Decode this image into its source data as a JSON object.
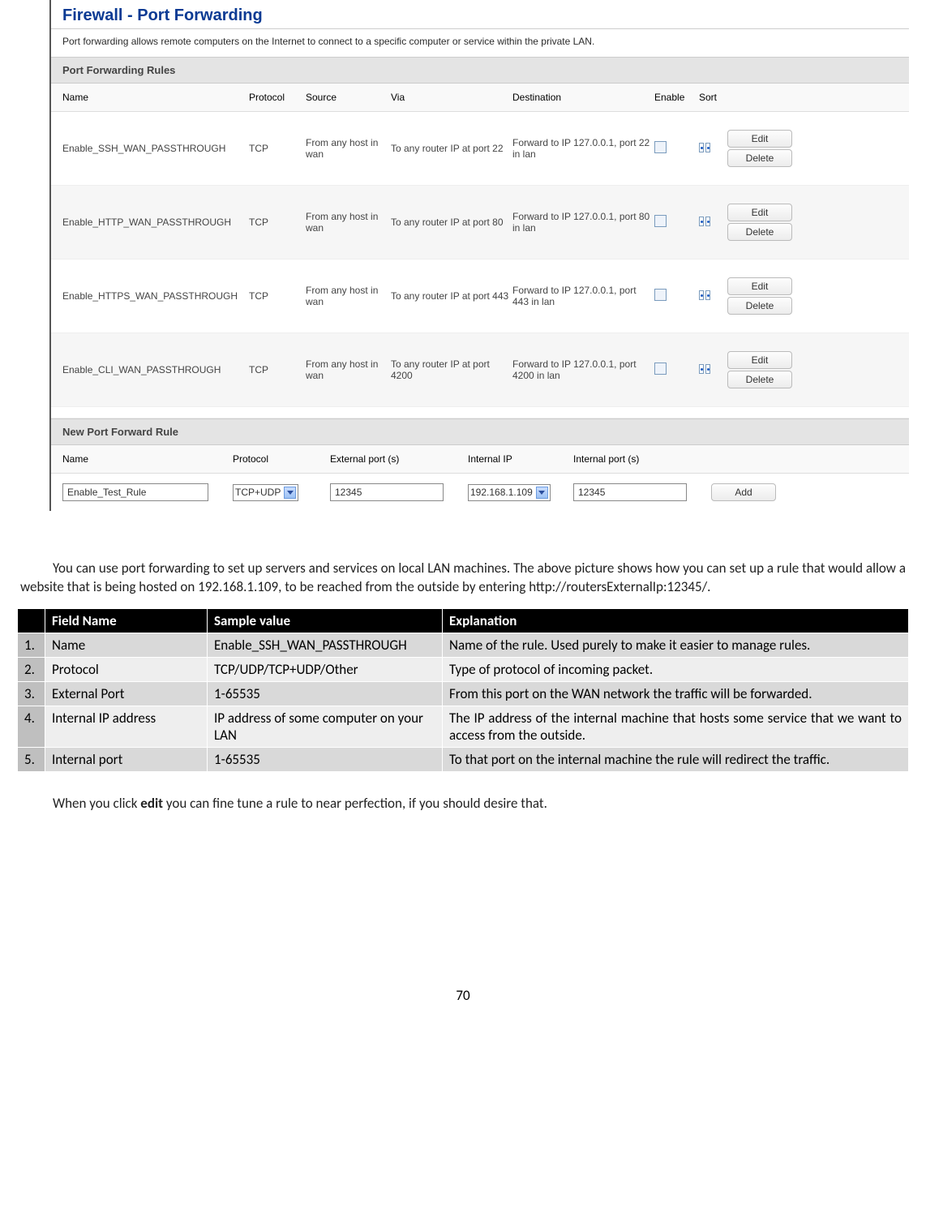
{
  "panel": {
    "title": "Firewall - Port Forwarding",
    "desc": "Port forwarding allows remote computers on the Internet to connect to a specific computer or service within the private LAN.",
    "rules_section": "Port Forwarding Rules",
    "headers": {
      "name": "Name",
      "protocol": "Protocol",
      "source": "Source",
      "via": "Via",
      "destination": "Destination",
      "enable": "Enable",
      "sort": "Sort"
    },
    "rules": [
      {
        "name": "Enable_SSH_WAN_PASSTHROUGH",
        "protocol": "TCP",
        "source": "From any host in wan",
        "via": "To any router IP at port 22",
        "dest": "Forward to IP 127.0.0.1, port 22 in lan"
      },
      {
        "name": "Enable_HTTP_WAN_PASSTHROUGH",
        "protocol": "TCP",
        "source": "From any host in wan",
        "via": "To any router IP at port 80",
        "dest": "Forward to IP 127.0.0.1, port 80 in lan"
      },
      {
        "name": "Enable_HTTPS_WAN_PASSTHROUGH",
        "protocol": "TCP",
        "source": "From any host in wan",
        "via": "To any router IP at port 443",
        "dest": "Forward to IP 127.0.0.1, port 443 in lan"
      },
      {
        "name": "Enable_CLI_WAN_PASSTHROUGH",
        "protocol": "TCP",
        "source": "From any host in wan",
        "via": "To any router IP at port 4200",
        "dest": "Forward to IP 127.0.0.1, port 4200 in lan"
      }
    ],
    "btn_edit": "Edit",
    "btn_delete": "Delete",
    "new_section": "New Port Forward Rule",
    "form_headers": {
      "name": "Name",
      "protocol": "Protocol",
      "ext": "External port (s)",
      "intip": "Internal IP",
      "intp": "Internal port (s)"
    },
    "form": {
      "name": "Enable_Test_Rule",
      "protocol": "TCP+UDP",
      "ext": "12345",
      "intip": "192.168.1.109",
      "intp": "12345",
      "add": "Add"
    }
  },
  "body1": "You can use port forwarding to set up servers and services on local LAN machines. The above picture shows how you can set up a rule that would allow a website that is being hosted on 192.168.1.109, to be reached from the outside by entering http://routersExternalIp:12345/.",
  "table": {
    "head": {
      "field": "Field Name",
      "sample": "Sample value",
      "expl": "Explanation"
    },
    "rows": [
      {
        "n": "1.",
        "field": "Name",
        "sample": "Enable_SSH_WAN_PASSTHROUGH",
        "expl": "Name of the rule. Used purely to make it easier to manage rules."
      },
      {
        "n": "2.",
        "field": "Protocol",
        "sample": "TCP/UDP/TCP+UDP/Other",
        "expl": "Type of protocol of incoming packet."
      },
      {
        "n": "3.",
        "field": "External Port",
        "sample": "1-65535",
        "expl": "From this port on the WAN network the traffic will be forwarded."
      },
      {
        "n": "4.",
        "field": "Internal IP address",
        "sample": "IP address of some computer on your LAN",
        "expl": "The IP address of the internal machine that hosts some service that we want to access from the outside."
      },
      {
        "n": "5.",
        "field": "Internal port",
        "sample": "1-65535",
        "expl": "To that port on the internal machine the rule will redirect the traffic."
      }
    ]
  },
  "body2_a": "When you click ",
  "body2_bold": "edit",
  "body2_b": " you can fine tune a rule to near perfection, if you should desire that.",
  "page_number": "70"
}
